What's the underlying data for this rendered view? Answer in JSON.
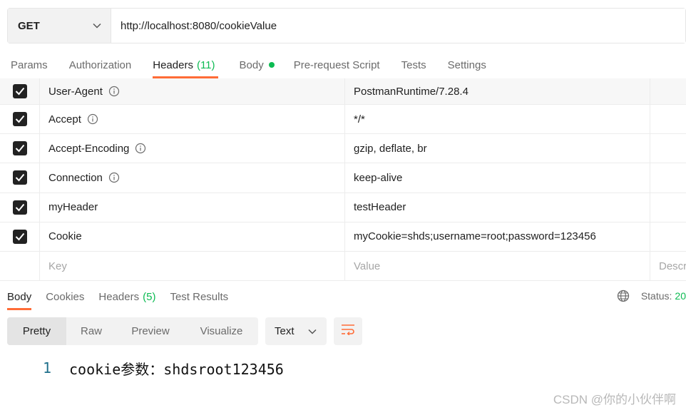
{
  "request": {
    "method": "GET",
    "url": "http://localhost:8080/cookieValue"
  },
  "request_tabs": {
    "params": "Params",
    "authorization": "Authorization",
    "headers": "Headers",
    "headers_count": "(11)",
    "body": "Body",
    "pre_request": "Pre-request Script",
    "tests": "Tests",
    "settings": "Settings"
  },
  "headers": {
    "rows": [
      {
        "key": "User-Agent",
        "value": "PostmanRuntime/7.28.4",
        "checked": true
      },
      {
        "key": "Accept",
        "value": "*/*",
        "checked": true
      },
      {
        "key": "Accept-Encoding",
        "value": "gzip, deflate, br",
        "checked": true
      },
      {
        "key": "Connection",
        "value": "keep-alive",
        "checked": true
      },
      {
        "key": "myHeader",
        "value": "testHeader",
        "checked": true
      },
      {
        "key": "Cookie",
        "value": "myCookie=shds;username=root;password=123456",
        "checked": true
      }
    ],
    "key_placeholder": "Key",
    "value_placeholder": "Value",
    "description_placeholder": "Descr"
  },
  "response_tabs": {
    "body": "Body",
    "cookies": "Cookies",
    "headers": "Headers",
    "headers_count": "(5)",
    "test_results": "Test Results"
  },
  "status": {
    "label": "Status:",
    "value": "20"
  },
  "format": {
    "pretty": "Pretty",
    "raw": "Raw",
    "preview": "Preview",
    "visualize": "Visualize",
    "language": "Text"
  },
  "response_body": {
    "line_number": "1",
    "text": "cookie参数：shdsroot123456"
  },
  "watermark": "CSDN @你的小伙伴啊",
  "colors": {
    "accent": "#ff6c37",
    "success": "#0cbb52"
  },
  "icons": [
    "chevron-down-icon",
    "info-icon",
    "checkbox-checked-icon",
    "globe-icon",
    "wrap-lines-icon"
  ]
}
